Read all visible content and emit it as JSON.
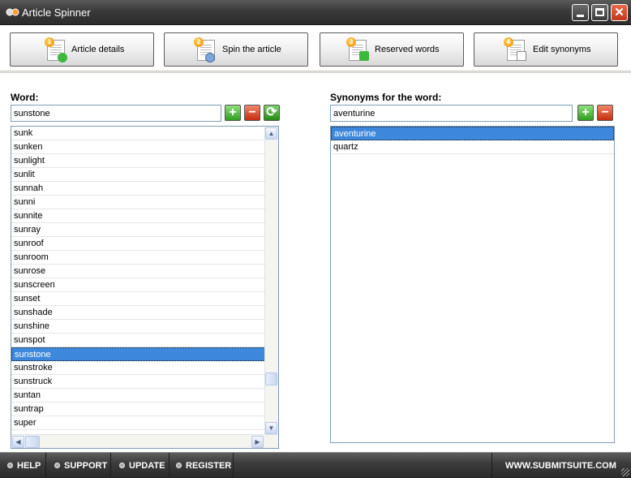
{
  "window": {
    "title": "Article Spinner"
  },
  "toolbar": {
    "buttons": [
      {
        "num": "1",
        "label": "Article details"
      },
      {
        "num": "2",
        "label": "Spin the article"
      },
      {
        "num": "3",
        "label": "Reserved words"
      },
      {
        "num": "4",
        "label": "Edit synonyms"
      }
    ]
  },
  "word_panel": {
    "label": "Word:",
    "input_value": "sunstone",
    "items": [
      "sunk",
      "sunken",
      "sunlight",
      "sunlit",
      "sunnah",
      "sunni",
      "sunnite",
      "sunray",
      "sunroof",
      "sunroom",
      "sunrose",
      "sunscreen",
      "sunset",
      "sunshade",
      "sunshine",
      "sunspot",
      "sunstone",
      "sunstroke",
      "sunstruck",
      "suntan",
      "suntrap",
      "super"
    ],
    "selected": "sunstone"
  },
  "synonym_panel": {
    "label": "Synonyms for the word:",
    "input_value": "aventurine",
    "items": [
      "aventurine",
      "quartz"
    ],
    "selected": "aventurine"
  },
  "footer": {
    "help": "HELP",
    "support": "SUPPORT",
    "update": "UPDATE",
    "register": "REGISTER",
    "website": "WWW.SUBMITSUITE.COM"
  },
  "icons": {
    "add": "plus-icon",
    "remove": "minus-icon",
    "refresh": "refresh-icon"
  },
  "colors": {
    "selection": "#3d88dc",
    "title_bar": "#3a3a3a",
    "close_button": "#c1361a",
    "add_button": "#2f9e1e",
    "remove_button": "#c82c10"
  }
}
